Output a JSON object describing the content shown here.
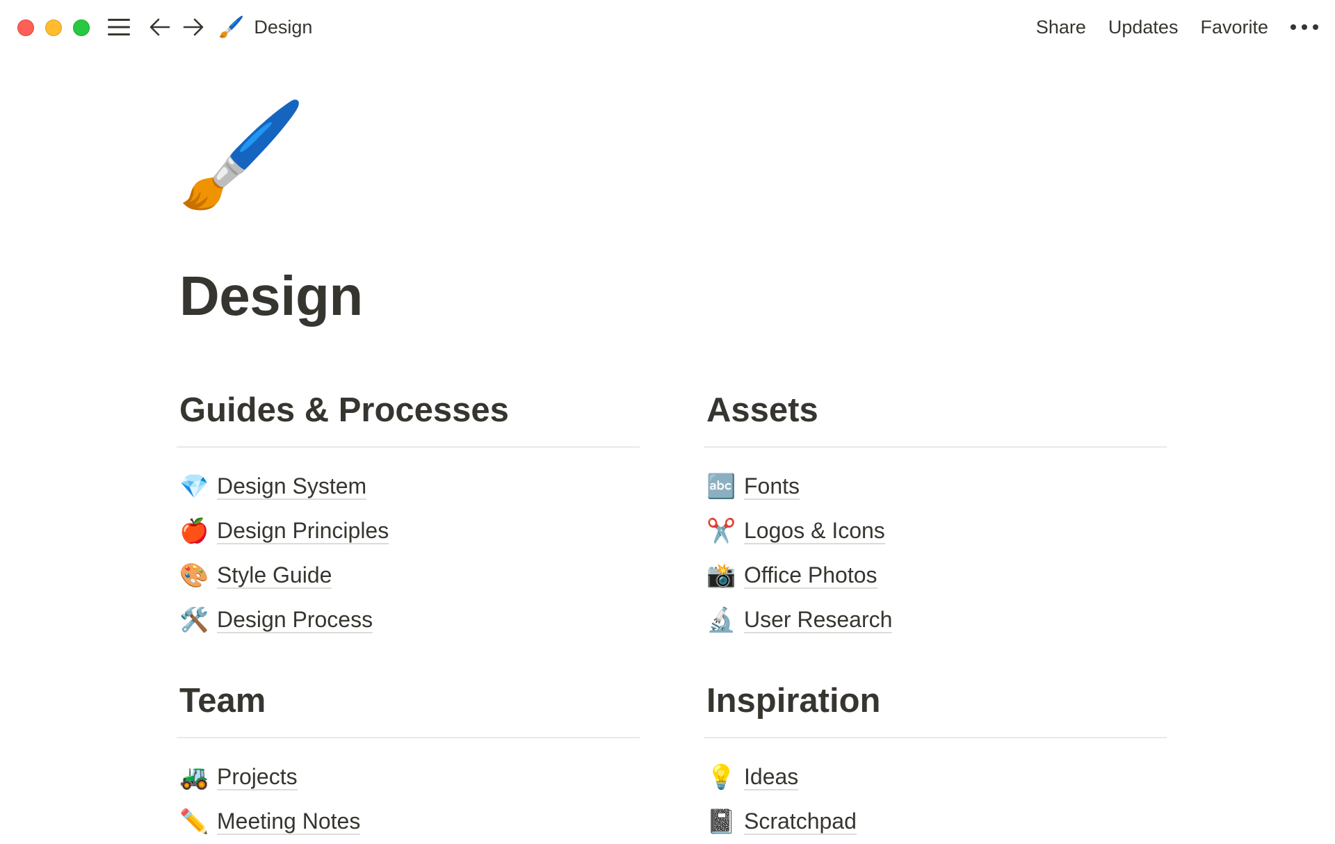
{
  "window": {
    "controls": [
      "close",
      "minimize",
      "maximize"
    ]
  },
  "topbar": {
    "breadcrumb": {
      "icon": "🖌️",
      "label": "Design"
    },
    "actions": {
      "share": "Share",
      "updates": "Updates",
      "favorite": "Favorite"
    }
  },
  "page": {
    "icon": "🖌️",
    "title": "Design"
  },
  "sections": {
    "guides": {
      "title": "Guides & Processes",
      "items": [
        {
          "icon": "💎",
          "label": "Design System"
        },
        {
          "icon": "🍎",
          "label": "Design Principles"
        },
        {
          "icon": "🎨",
          "label": "Style Guide"
        },
        {
          "icon": "🛠️",
          "label": "Design Process"
        }
      ]
    },
    "assets": {
      "title": "Assets",
      "items": [
        {
          "icon": "🔤",
          "label": "Fonts"
        },
        {
          "icon": "✂️",
          "label": "Logos & Icons"
        },
        {
          "icon": "📸",
          "label": "Office Photos"
        },
        {
          "icon": "🔬",
          "label": "User Research"
        }
      ]
    },
    "team": {
      "title": "Team",
      "items": [
        {
          "icon": "🚜",
          "label": "Projects"
        },
        {
          "icon": "✏️",
          "label": "Meeting Notes"
        }
      ]
    },
    "inspiration": {
      "title": "Inspiration",
      "items": [
        {
          "icon": "💡",
          "label": "Ideas"
        },
        {
          "icon": "📓",
          "label": "Scratchpad"
        }
      ]
    }
  }
}
